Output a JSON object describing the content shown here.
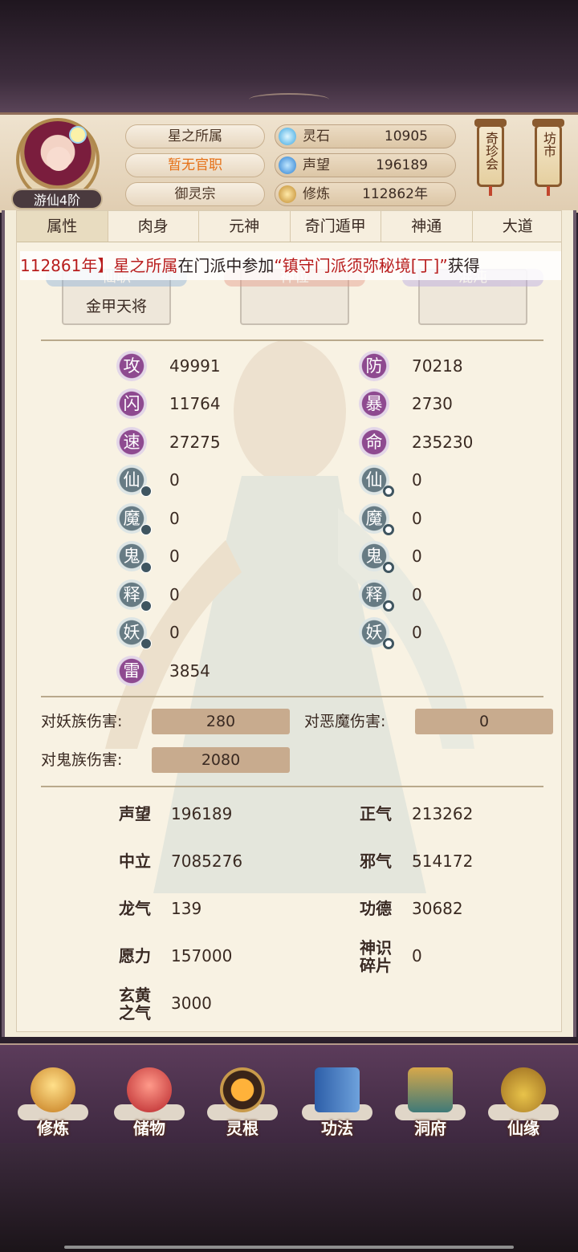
{
  "header": {
    "rank_tag": "游仙4阶",
    "name": "星之所属",
    "official_post": "暂无官职",
    "sect": "御灵宗",
    "resources": [
      {
        "icon": "spirit-stone-icon",
        "label": "灵石",
        "value": "10905"
      },
      {
        "icon": "reputation-icon",
        "label": "声望",
        "value": "196189"
      },
      {
        "icon": "cultivation-icon",
        "label": "修炼",
        "value": "112862年"
      }
    ],
    "side_buttons": [
      "奇珍会",
      "坊市"
    ]
  },
  "tabs": [
    "属性",
    "肉身",
    "元神",
    "奇门遁甲",
    "神通",
    "大道"
  ],
  "ticker": {
    "year": "112861年】",
    "name": "星之所属",
    "text": "在门派中参加",
    "event": "“镇守门派须弥秘境[丁]”",
    "tail": "获得"
  },
  "slots": [
    {
      "badge": "仙职",
      "value": "金甲天将"
    },
    {
      "badge": "神位",
      "value": ""
    },
    {
      "badge": "混沌",
      "value": ""
    }
  ],
  "stats_left": [
    {
      "icon": "攻",
      "value": "49991"
    },
    {
      "icon": "闪",
      "value": "11764"
    },
    {
      "icon": "速",
      "value": "27275"
    },
    {
      "icon": "仙",
      "value": "0"
    },
    {
      "icon": "魔",
      "value": "0"
    },
    {
      "icon": "鬼",
      "value": "0"
    },
    {
      "icon": "释",
      "value": "0"
    },
    {
      "icon": "妖",
      "value": "0"
    },
    {
      "icon": "雷",
      "value": "3854"
    }
  ],
  "stats_right": [
    {
      "icon": "防",
      "value": "70218"
    },
    {
      "icon": "暴",
      "value": "2730"
    },
    {
      "icon": "命",
      "value": "235230"
    },
    {
      "icon": "仙",
      "value": "0"
    },
    {
      "icon": "魔",
      "value": "0"
    },
    {
      "icon": "鬼",
      "value": "0"
    },
    {
      "icon": "释",
      "value": "0"
    },
    {
      "icon": "妖",
      "value": "0"
    }
  ],
  "damage": [
    {
      "label": "对妖族伤害:",
      "value": "280"
    },
    {
      "label": "对恶魔伤害:",
      "value": "0"
    },
    {
      "label": "对鬼族伤害:",
      "value": "2080"
    }
  ],
  "reputation": [
    {
      "label": "声望",
      "value": "196189"
    },
    {
      "label": "正气",
      "value": "213262"
    },
    {
      "label": "中立",
      "value": "7085276"
    },
    {
      "label": "邪气",
      "value": "514172"
    },
    {
      "label": "龙气",
      "value": "139"
    },
    {
      "label": "功德",
      "value": "30682"
    },
    {
      "label": "愿力",
      "value": "157000"
    },
    {
      "label": "神识碎片",
      "value": "0"
    },
    {
      "label": "玄黄之气",
      "value": "3000"
    }
  ],
  "nav": [
    "修炼",
    "储物",
    "灵根",
    "功法",
    "洞府",
    "仙缘"
  ],
  "colors": {
    "accent_red": "#b81d1d",
    "orange": "#e57016",
    "stat_purple": "#8e4a90",
    "stat_grey": "#677b84"
  }
}
